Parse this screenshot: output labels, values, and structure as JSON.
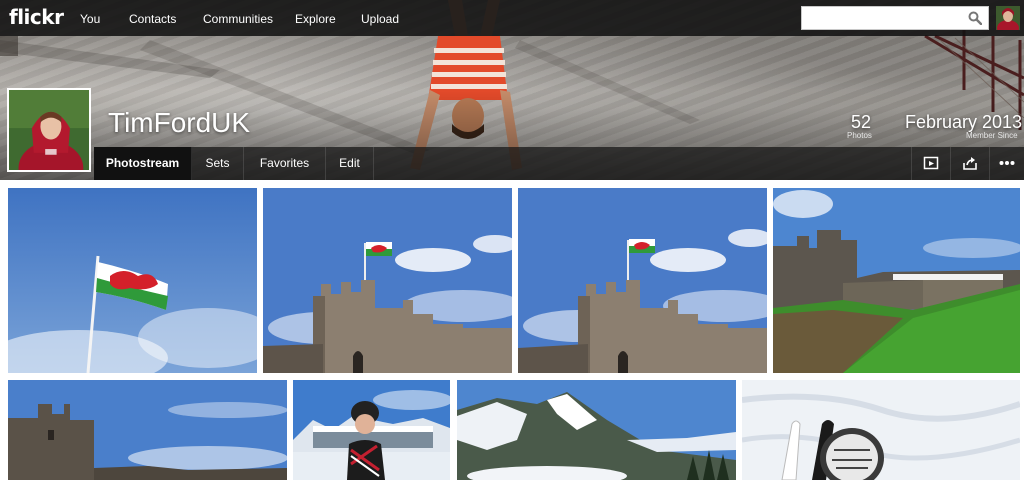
{
  "brand": {
    "logo_text": "flickr"
  },
  "nav": {
    "items": [
      {
        "label": "You"
      },
      {
        "label": "Contacts"
      },
      {
        "label": "Communities"
      },
      {
        "label": "Explore"
      },
      {
        "label": "Upload"
      }
    ],
    "search": {
      "value": "",
      "placeholder": ""
    }
  },
  "profile": {
    "username": "TimFordUK",
    "photos_count": "52",
    "photos_label": "Photos",
    "member_since_value": "February 2013",
    "member_since_label": "Member Since"
  },
  "tabs": [
    {
      "label": "Photostream",
      "active": true
    },
    {
      "label": "Sets",
      "active": false
    },
    {
      "label": "Favorites",
      "active": false
    },
    {
      "label": "Edit",
      "active": false
    }
  ],
  "tools": [
    {
      "icon": "slideshow-icon"
    },
    {
      "icon": "share-icon"
    },
    {
      "icon": "more-icon"
    }
  ],
  "photos": [
    {
      "subject": "welsh-flag-sky"
    },
    {
      "subject": "castle-tower-flag"
    },
    {
      "subject": "castle-tower-flag"
    },
    {
      "subject": "castle-moat-grass"
    },
    {
      "subject": "castle-tower"
    },
    {
      "subject": "skier-portrait"
    },
    {
      "subject": "snowy-mountains"
    },
    {
      "subject": "ski-tips-snow"
    }
  ],
  "colors": {
    "nav_bg": "#121212",
    "sky": "#4a7bc4",
    "grass": "#3c9a2a",
    "flag_red": "#d4202a"
  }
}
